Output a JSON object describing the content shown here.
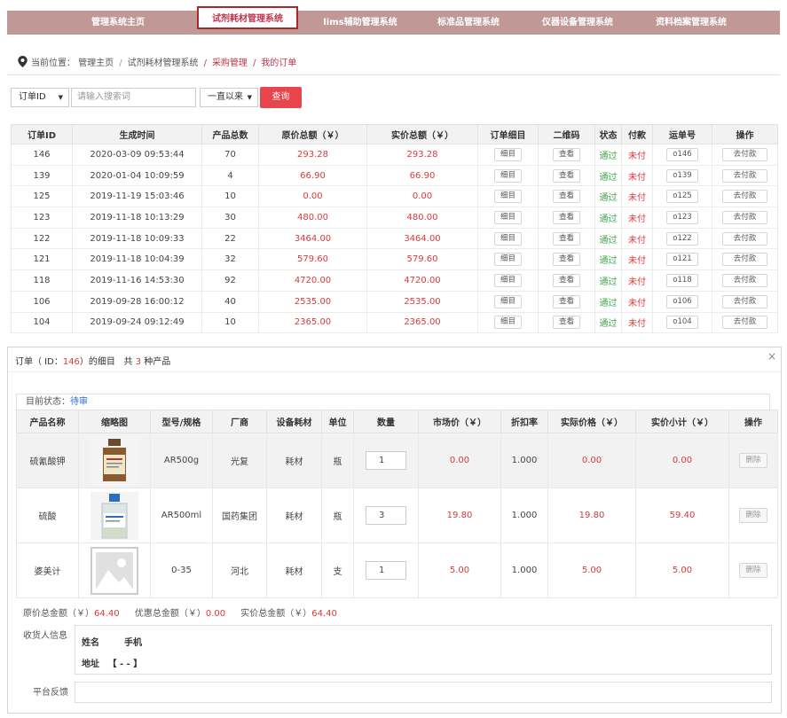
{
  "nav": {
    "tabs": [
      {
        "label": "管理系统主页"
      },
      {
        "label": "试剂耗材管理系统"
      },
      {
        "label": "lims辅助管理系统"
      },
      {
        "label": "标准品管理系统"
      },
      {
        "label": "仪器设备管理系统"
      },
      {
        "label": "资料档案管理系统"
      }
    ]
  },
  "breadcrumb": {
    "prefix": "当前位置：",
    "items": [
      "管理主页",
      "试剂耗材管理系统",
      "采购管理",
      "我的订单"
    ]
  },
  "search": {
    "field_select": "订单ID",
    "placeholder": "请输入搜索词",
    "range_select": "一直以来",
    "button": "查询"
  },
  "orders": {
    "columns": [
      "订单ID",
      "生成时间",
      "产品总数",
      "原价总额（￥）",
      "实价总额（￥）",
      "订单细目",
      "二维码",
      "状态",
      "付款",
      "运单号",
      "操作"
    ],
    "detail_btn": "细目",
    "qr_btn": "查看",
    "pay_btn": "去付款",
    "rows": [
      {
        "id": "146",
        "time": "2020-03-09 09:53:44",
        "count": "70",
        "orig": "293.28",
        "real": "293.28",
        "status": "通过",
        "pay": "未付",
        "waybill": "o146"
      },
      {
        "id": "139",
        "time": "2020-01-04 10:09:59",
        "count": "4",
        "orig": "66.90",
        "real": "66.90",
        "status": "通过",
        "pay": "未付",
        "waybill": "o139"
      },
      {
        "id": "125",
        "time": "2019-11-19 15:03:46",
        "count": "10",
        "orig": "0.00",
        "real": "0.00",
        "status": "通过",
        "pay": "未付",
        "waybill": "o125"
      },
      {
        "id": "123",
        "time": "2019-11-18 10:13:29",
        "count": "30",
        "orig": "480.00",
        "real": "480.00",
        "status": "通过",
        "pay": "未付",
        "waybill": "o123"
      },
      {
        "id": "122",
        "time": "2019-11-18 10:09:33",
        "count": "22",
        "orig": "3464.00",
        "real": "3464.00",
        "status": "通过",
        "pay": "未付",
        "waybill": "o122"
      },
      {
        "id": "121",
        "time": "2019-11-18 10:04:39",
        "count": "32",
        "orig": "579.60",
        "real": "579.60",
        "status": "通过",
        "pay": "未付",
        "waybill": "o121"
      },
      {
        "id": "118",
        "time": "2019-11-16 14:53:30",
        "count": "92",
        "orig": "4720.00",
        "real": "4720.00",
        "status": "通过",
        "pay": "未付",
        "waybill": "o118"
      },
      {
        "id": "106",
        "time": "2019-09-28 16:00:12",
        "count": "40",
        "orig": "2535.00",
        "real": "2535.00",
        "status": "通过",
        "pay": "未付",
        "waybill": "o106"
      },
      {
        "id": "104",
        "time": "2019-09-24 09:12:49",
        "count": "10",
        "orig": "2365.00",
        "real": "2365.00",
        "status": "通过",
        "pay": "未付",
        "waybill": "o104"
      }
    ]
  },
  "modal": {
    "title_pre": "订单（ ID：",
    "order_id": "146",
    "title_mid": "）的细目",
    "title_count_pre": "共",
    "product_count": "3",
    "title_count_post": "种产品",
    "close": "×",
    "status_label": "目前状态：",
    "status_value": "待审",
    "columns": [
      "产品名称",
      "缩略图",
      "型号/规格",
      "厂商",
      "设备耗材",
      "单位",
      "数量",
      "市场价（￥）",
      "折扣率",
      "实际价格（￥）",
      "实价小计（￥）",
      "操作"
    ],
    "delete_btn": "删除",
    "items": [
      {
        "name": "硫氰酸钾",
        "model": "AR500g",
        "maker": "光复",
        "kind": "耗材",
        "unit": "瓶",
        "qty": "1",
        "market": "0.00",
        "discount": "1.000",
        "price": "0.00",
        "subtotal": "0.00",
        "thumb": "brown-bottle"
      },
      {
        "name": "硫酸",
        "model": "AR500ml",
        "maker": "国药集团",
        "kind": "耗材",
        "unit": "瓶",
        "qty": "3",
        "market": "19.80",
        "discount": "1.000",
        "price": "19.80",
        "subtotal": "59.40",
        "thumb": "clear-bottle"
      },
      {
        "name": "婆美计",
        "model": "0-35",
        "maker": "河北",
        "kind": "耗材",
        "unit": "支",
        "qty": "1",
        "market": "5.00",
        "discount": "1.000",
        "price": "5.00",
        "subtotal": "5.00",
        "thumb": "image-placeholder"
      }
    ],
    "totals": {
      "orig_label": "原价总金额（￥）",
      "orig_value": "64.40",
      "discount_label": "优惠总金额（￥）",
      "discount_value": "0.00",
      "real_label": "实价总金额（￥）",
      "real_value": "64.40"
    },
    "receiver_label": "收货人信息",
    "receiver": {
      "name_label": "姓名",
      "phone_label": "手机",
      "addr_label": "地址",
      "addr_value": "【 - - 】"
    },
    "feedback_label": "平台反馈"
  },
  "colors": {
    "nav_bg": "#c09896",
    "accent_red": "#e8454c",
    "price_red": "#d83a3a",
    "status_green": "#3fa64a",
    "status_blue": "#2a6dc4"
  }
}
